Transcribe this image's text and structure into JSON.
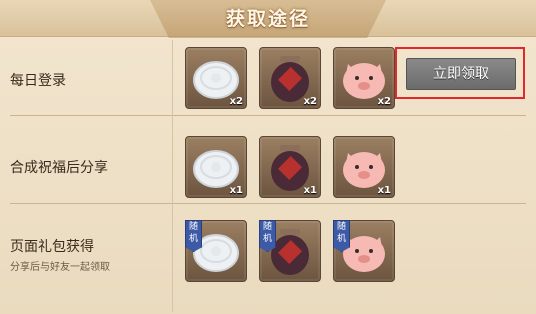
{
  "header": {
    "title": "获取途径"
  },
  "rows": [
    {
      "label": "每日登录",
      "items": [
        {
          "name": "mooncake",
          "count": "x2"
        },
        {
          "name": "wine-jar",
          "count": "x2"
        },
        {
          "name": "pig",
          "count": "x2"
        }
      ],
      "button": "立即领取"
    },
    {
      "label": "合成祝福后分享",
      "items": [
        {
          "name": "mooncake",
          "count": "x1"
        },
        {
          "name": "wine-jar",
          "count": "x1"
        },
        {
          "name": "pig",
          "count": "x1"
        }
      ]
    },
    {
      "label": "页面礼包获得",
      "sub": "分享后与好友一起领取",
      "items": [
        {
          "name": "mooncake",
          "tag": "随机"
        },
        {
          "name": "wine-jar",
          "tag": "随机"
        },
        {
          "name": "pig",
          "tag": "随机"
        }
      ]
    }
  ]
}
